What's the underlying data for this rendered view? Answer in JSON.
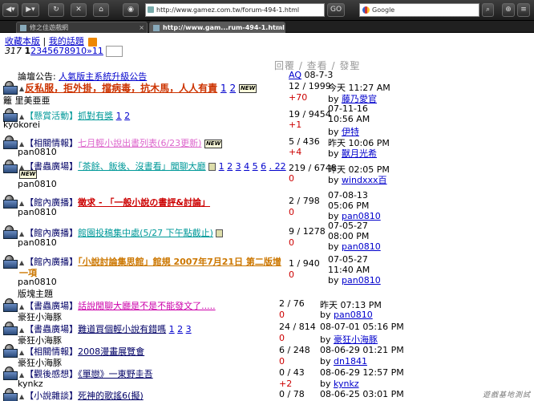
{
  "browser": {
    "url": "http://www.gamez.com.tw/forum-494-1.html",
    "search_placeholder": "Google",
    "buttons": {
      "go": "GO"
    },
    "tabs": [
      {
        "title": "修之佳遊戲網",
        "active": false
      },
      {
        "title": "http://www.gam...rum-494-1.html",
        "active": true
      }
    ]
  },
  "top_links": {
    "favorites": "收藏本版",
    "my_topics": "我的話題"
  },
  "pagination": {
    "prefix": "317",
    "current": "1",
    "pages": "2345678910",
    "more": "»11"
  },
  "column_header": "回覆 / 查看 / 發聖",
  "announcement": {
    "label": "論壇公告:",
    "title": "人氣版主系統升級公告",
    "author": "AQ",
    "date": "08-7-3"
  },
  "section_label": "版塊主題",
  "threads": [
    {
      "category": "",
      "title": "反私服，拒外掛，擋病毒，抗木馬，人人有責",
      "title_line2": "籬 里美亜亜",
      "pages": [
        "1",
        "2"
      ],
      "new": true,
      "author": "",
      "replies": "12 / 1999",
      "views": "+70",
      "last_time": "今天 11:27 AM",
      "last_by": "by",
      "last_user": "藤乃愛官"
    },
    {
      "category": "【懸賞活動】",
      "title": "抓對有獎",
      "pages": [
        "1",
        "2"
      ],
      "new": false,
      "author": "kyokorei",
      "replies": "19 / 9454",
      "views": "+1",
      "last_time": "07-11-16 10:56 AM",
      "last_by": "by",
      "last_user": "伊特"
    },
    {
      "category": "【相關情報】",
      "title": "七月輕小說出書列表(6/23更新)",
      "pages": [],
      "new": true,
      "author": "pan0810",
      "replies": "5 / 436",
      "views": "+4",
      "last_time": "昨天 10:06 PM",
      "last_by": "by",
      "last_user": "獸月光希"
    },
    {
      "category": "【書蟲廣場】",
      "title": "「茶餘、飯後、沒書看」聞聊大廳",
      "pages": [
        "1",
        "2",
        "3",
        "4",
        "5",
        "6",
        ". 22"
      ],
      "new": true,
      "author": "pan0810",
      "replies": "219 / 6748",
      "views": "0",
      "last_time": "昨天 02:05 PM",
      "last_by": "by",
      "last_user": "windxxx百"
    },
    {
      "category": "【館內廣播】",
      "title": "徵求 - 「一般小說の書評&討論」",
      "pages": [],
      "new": false,
      "author": "pan0810",
      "replies": "2 / 798",
      "views": "0",
      "last_time": "07-08-13 05:06 PM",
      "last_time2": "07-05-27 08:00 PM",
      "last_by": "by",
      "last_user": "pan0810"
    },
    {
      "category": "【館內廣播】",
      "title": "館園投稿集中處(5/27 下午點截止)",
      "pages": [],
      "new": false,
      "author": "pan0810",
      "replies": "9 / 1278",
      "views": "0",
      "last_time": "07-05-27 08:00 PM",
      "last_by": "by",
      "last_user": "pan0810"
    },
    {
      "category": "【館內廣播】",
      "title": "「小說討論集思館」館規 2007年7月21日 第二版增",
      "title_line2": "一項",
      "pages": [],
      "new": false,
      "author": "pan0810",
      "replies": "1 / 940",
      "views": "0",
      "last_time": "07-05-27 11:40 AM",
      "last_by": "by",
      "last_user": "pan0810"
    },
    {
      "category": "【書蟲廣場】",
      "title": "話說閒聊大廳是不是不能發文了.....",
      "pages": [],
      "new": false,
      "author": "豪狂小海豚",
      "replies": "2 / 76",
      "views": "0",
      "last_time": "昨天 07:13 PM",
      "last_by": "by",
      "last_user": "pan0810"
    },
    {
      "category": "【書蟲廣場】",
      "title": "難道買個輕小說有錯嗎",
      "pages": [
        "1",
        "2",
        "3"
      ],
      "new": false,
      "author": "豪狂小海豚",
      "replies": "24 / 814",
      "views": "0",
      "last_time": "08-07-01 05:16 PM",
      "last_by": "by",
      "last_user": "豪狂小海豚"
    },
    {
      "category": "【相關情報】",
      "title": "2008漫畫展覽會",
      "pages": [],
      "new": false,
      "author": "豪狂小海豚",
      "replies": "6 / 248",
      "views": "0",
      "last_time": "08-06-29 01:21 PM",
      "last_by": "by",
      "last_user": "dn1841"
    },
    {
      "category": "【觀後感想】",
      "title": "《單戀》一東野圭吾",
      "pages": [],
      "new": false,
      "author": "kynkz",
      "replies": "0 / 43",
      "views": "+2",
      "last_time": "08-06-29 12:57 PM",
      "last_by": "by",
      "last_user": "kynkz"
    },
    {
      "category": "【小說雜談】",
      "title": "死神的歌謠6(擬)",
      "pages": [],
      "new": false,
      "author": "",
      "replies": "0 / 78",
      "views": "",
      "last_time": "08-06-25 03:01 PM",
      "last_by": "",
      "last_user": ""
    }
  ],
  "watermark": "遊戲基地測試"
}
